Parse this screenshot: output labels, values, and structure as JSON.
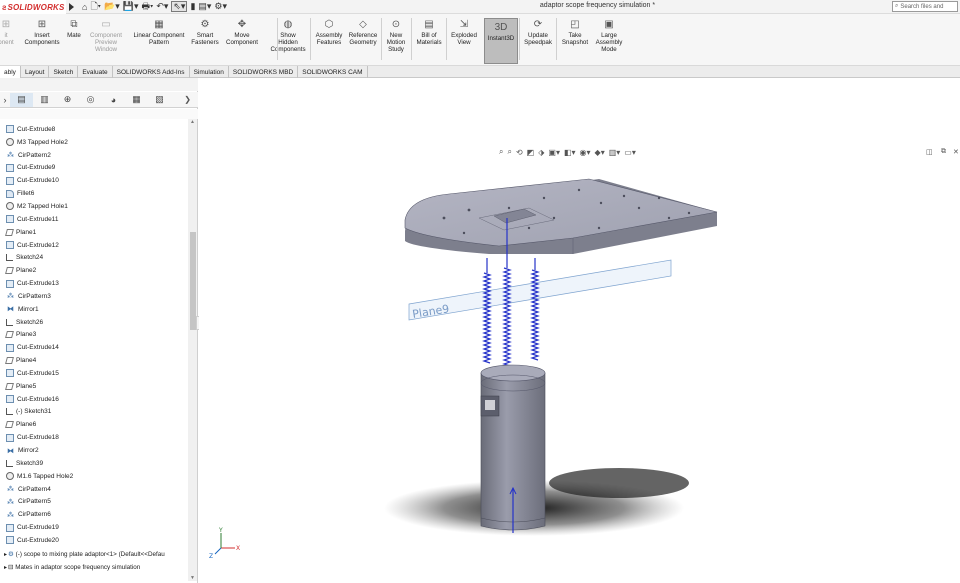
{
  "app": {
    "logo_text": "SOLIDWORKS",
    "window_title": "adaptor scope frequency simulation *",
    "search_placeholder": "Search files and"
  },
  "ribbon": {
    "buttons": [
      {
        "label": "Insert Components",
        "icon": "insert-components-icon",
        "dim": false
      },
      {
        "label": "Mate",
        "icon": "mate-icon",
        "dim": false
      },
      {
        "label": "Component Preview Window",
        "icon": "component-preview-icon",
        "dim": true
      },
      {
        "label": "Linear Component Pattern",
        "icon": "linear-pattern-icon",
        "dim": false
      },
      {
        "label": "Smart Fasteners",
        "icon": "smart-fasteners-icon",
        "dim": false
      },
      {
        "label": "Move Component",
        "icon": "move-component-icon",
        "dim": false
      },
      {
        "label": "Show Hidden Components",
        "icon": "show-hidden-icon",
        "dim": false
      },
      {
        "label": "Assembly Features",
        "icon": "assembly-features-icon",
        "dim": false
      },
      {
        "label": "Reference Geometry",
        "icon": "reference-geometry-icon",
        "dim": false
      },
      {
        "label": "New Motion Study",
        "icon": "motion-study-icon",
        "dim": false
      },
      {
        "label": "Bill of Materials",
        "icon": "bom-icon",
        "dim": false
      },
      {
        "label": "Exploded View",
        "icon": "exploded-view-icon",
        "dim": false
      },
      {
        "label": "Instant3D",
        "icon": "instant3d-icon",
        "dim": false
      },
      {
        "label": "Update Speedpak",
        "icon": "speedpak-icon",
        "dim": false
      },
      {
        "label": "Take Snapshot",
        "icon": "snapshot-icon",
        "dim": false
      },
      {
        "label": "Large Assembly Mode",
        "icon": "large-assembly-icon",
        "dim": false
      }
    ],
    "partial_left_label": "it\nonent",
    "active_index": 12
  },
  "tabs": [
    "ably",
    "Layout",
    "Sketch",
    "Evaluate",
    "SOLIDWORKS Add-Ins",
    "Simulation",
    "SOLIDWORKS MBD",
    "SOLIDWORKS CAM"
  ],
  "tree": {
    "items": [
      {
        "label": "Cut-Extrude8",
        "type": "cut"
      },
      {
        "label": "M3 Tapped Hole2",
        "type": "hole"
      },
      {
        "label": "CirPattern2",
        "type": "pattern"
      },
      {
        "label": "Cut-Extrude9",
        "type": "cut"
      },
      {
        "label": "Cut-Extrude10",
        "type": "cut"
      },
      {
        "label": "Fillet6",
        "type": "fillet"
      },
      {
        "label": "M2 Tapped Hole1",
        "type": "hole"
      },
      {
        "label": "Cut-Extrude11",
        "type": "cut"
      },
      {
        "label": "Plane1",
        "type": "plane"
      },
      {
        "label": "Cut-Extrude12",
        "type": "cut"
      },
      {
        "label": "Sketch24",
        "type": "sketch"
      },
      {
        "label": "Plane2",
        "type": "plane"
      },
      {
        "label": "Cut-Extrude13",
        "type": "cut"
      },
      {
        "label": "CirPattern3",
        "type": "pattern"
      },
      {
        "label": "Mirror1",
        "type": "mirror"
      },
      {
        "label": "Sketch26",
        "type": "sketch"
      },
      {
        "label": "Plane3",
        "type": "plane"
      },
      {
        "label": "Cut-Extrude14",
        "type": "cut"
      },
      {
        "label": "Plane4",
        "type": "plane"
      },
      {
        "label": "Cut-Extrude15",
        "type": "cut"
      },
      {
        "label": "Plane5",
        "type": "plane"
      },
      {
        "label": "Cut-Extrude16",
        "type": "cut"
      },
      {
        "label": "(-) Sketch31",
        "type": "sketch"
      },
      {
        "label": "Plane6",
        "type": "plane"
      },
      {
        "label": "Cut-Extrude18",
        "type": "cut"
      },
      {
        "label": "Mirror2",
        "type": "mirror"
      },
      {
        "label": "Sketch39",
        "type": "sketch"
      },
      {
        "label": "M1.6 Tapped Hole2",
        "type": "hole"
      },
      {
        "label": "CirPattern4",
        "type": "pattern"
      },
      {
        "label": "CirPattern5",
        "type": "pattern"
      },
      {
        "label": "CirPattern6",
        "type": "pattern"
      },
      {
        "label": "Cut-Extrude19",
        "type": "cut"
      },
      {
        "label": "Cut-Extrude20",
        "type": "cut"
      }
    ],
    "component_row": "(-) scope to mixing plate adaptor<1> (Default<<Defau",
    "mates_row": "Mates in adaptor scope frequency simulation"
  },
  "viewport": {
    "plane_label": "Plane9",
    "triad": {
      "x": "X",
      "y": "Y",
      "z": "Z"
    }
  }
}
